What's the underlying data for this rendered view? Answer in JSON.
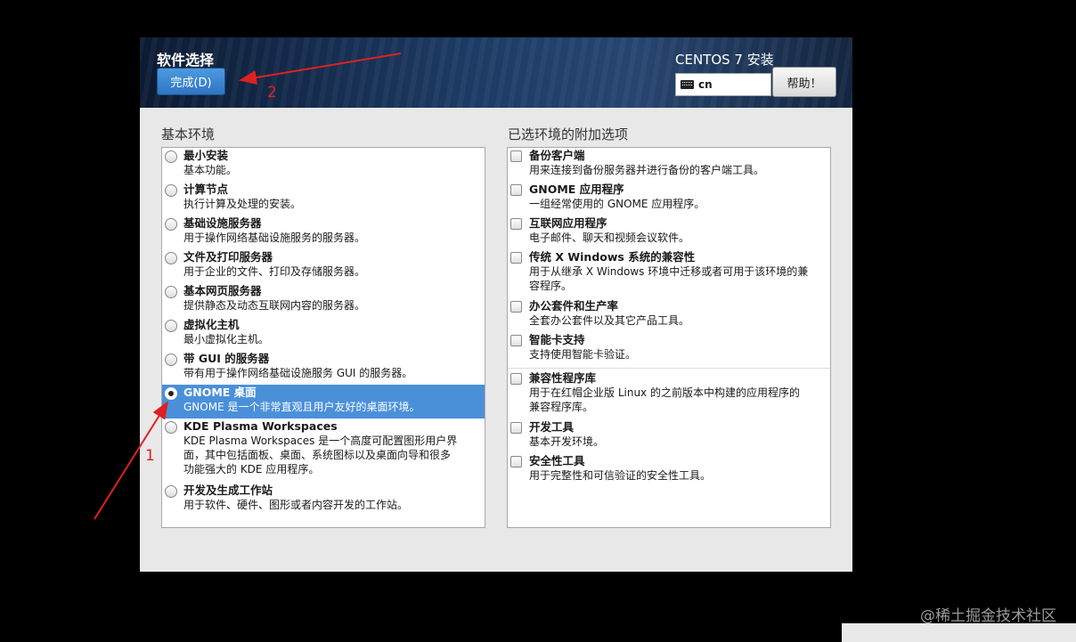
{
  "header": {
    "title": "软件选择",
    "done_label": "完成(D)",
    "install_title": "CENTOS 7 安装",
    "keyboard_value": "cn",
    "help_label": "帮助！"
  },
  "left": {
    "section_title": "基本环境",
    "items": [
      {
        "name": "最小安装",
        "desc": "基本功能。"
      },
      {
        "name": "计算节点",
        "desc": "执行计算及处理的安装。"
      },
      {
        "name": "基础设施服务器",
        "desc": "用于操作网络基础设施服务的服务器。"
      },
      {
        "name": "文件及打印服务器",
        "desc": "用于企业的文件、打印及存储服务器。"
      },
      {
        "name": "基本网页服务器",
        "desc": "提供静态及动态互联网内容的服务器。"
      },
      {
        "name": "虚拟化主机",
        "desc": "最小虚拟化主机。"
      },
      {
        "name": "带 GUI 的服务器",
        "desc": "带有用于操作网络基础设施服务 GUI 的服务器。"
      },
      {
        "name": "GNOME 桌面",
        "desc": "GNOME 是一个非常直观且用户友好的桌面环境。",
        "selected": true
      },
      {
        "name": "KDE Plasma Workspaces",
        "desc1": "KDE Plasma Workspaces 是一个高度可配置图形用户界",
        "desc2": "面，其中包括面板、桌面、系统图标以及桌面向导和很多",
        "desc3": "功能强大的 KDE 应用程序。"
      },
      {
        "name": "开发及生成工作站",
        "desc": "用于软件、硬件、图形或者内容开发的工作站。"
      }
    ]
  },
  "right": {
    "section_title": "已选环境的附加选项",
    "items": [
      {
        "name": "备份客户端",
        "desc": "用来连接到备份服务器并进行备份的客户端工具。"
      },
      {
        "name": "GNOME 应用程序",
        "desc": "一组经常使用的 GNOME 应用程序。"
      },
      {
        "name": "互联网应用程序",
        "desc": "电子邮件、聊天和视频会议软件。"
      },
      {
        "name": "传统 X Windows 系统的兼容性",
        "desc1": "用于从继承 X Windows 环境中迁移或者可用于该环境的兼",
        "desc2": "容程序。"
      },
      {
        "name": "办公套件和生产率",
        "desc": "全套办公套件以及其它产品工具。"
      },
      {
        "name": "智能卡支持",
        "desc": "支持使用智能卡验证。"
      },
      {
        "name": "兼容性程序库",
        "desc1": "用于在红帽企业版 Linux 的之前版本中构建的应用程序的",
        "desc2": "兼容程序库。"
      },
      {
        "name": "开发工具",
        "desc": "基本开发环境。"
      },
      {
        "name": "安全性工具",
        "desc": "用于完整性和可信验证的安全性工具。"
      }
    ]
  },
  "annotations": {
    "arrow1_label": "1",
    "arrow2_label": "2"
  },
  "watermark": "@稀土掘金技术社区",
  "colors": {
    "selected": "#4a90d9",
    "annotation": "#e02020",
    "done_button": "#3a86d4"
  }
}
